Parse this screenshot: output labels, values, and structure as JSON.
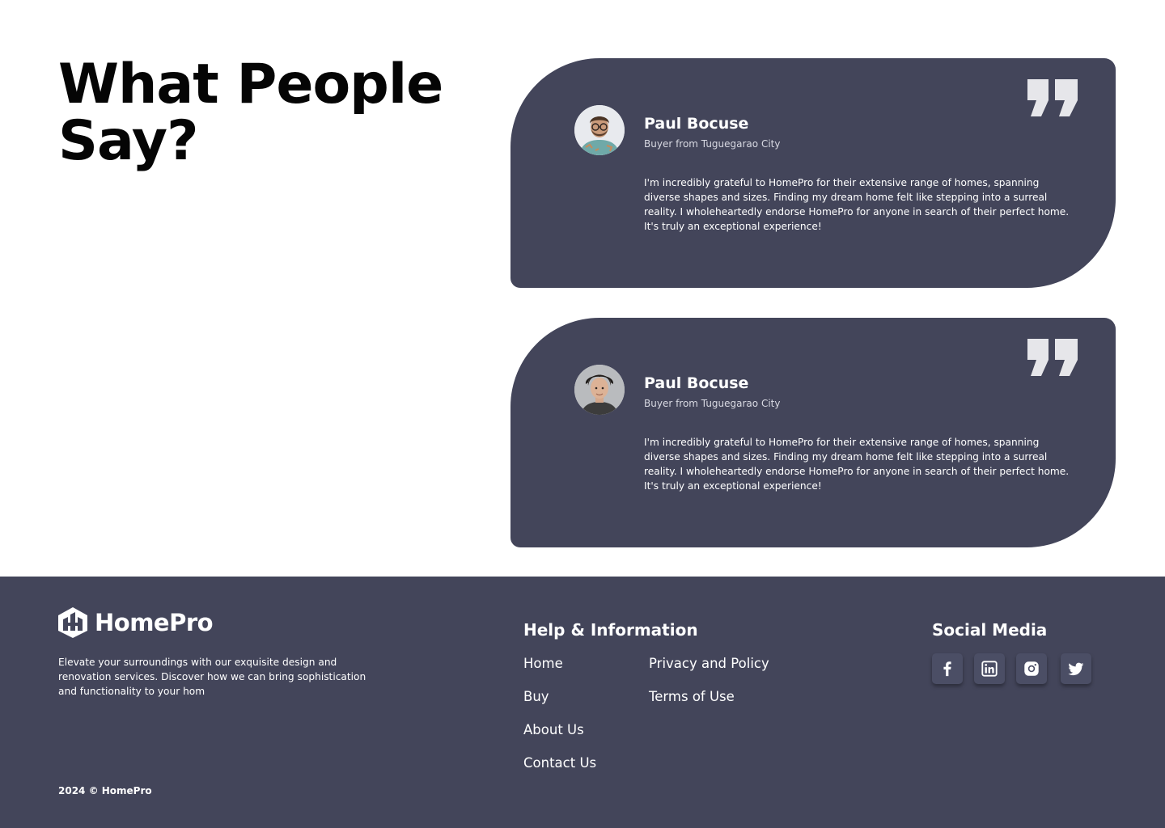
{
  "section": {
    "heading_line1": "What People",
    "heading_line2": "Say?"
  },
  "testimonials": [
    {
      "name": "Paul Bocuse",
      "role": "Buyer from Tuguegarao City",
      "text": "I'm incredibly grateful to HomePro for their extensive range of homes, spanning diverse shapes and sizes. Finding my dream home felt like stepping into a surreal reality. I wholeheartedly endorse HomePro for anyone in search of their perfect home. It's truly an exceptional experience!",
      "avatar_icon": "avatar-man-glasses-icon"
    },
    {
      "name": "Paul Bocuse",
      "role": "Buyer from Tuguegarao City",
      "text": "I'm incredibly grateful to HomePro for their extensive range of homes, spanning diverse shapes and sizes. Finding my dream home felt like stepping into a surreal reality. I wholeheartedly endorse HomePro for anyone in search of their perfect home. It's truly an exceptional experience!",
      "avatar_icon": "avatar-young-man-icon"
    }
  ],
  "footer": {
    "brand": "HomePro",
    "tagline": "Elevate your surroundings with our exquisite design and renovation services. Discover how we can bring sophistication and functionality to your hom",
    "copyright": "2024 © HomePro",
    "help_title": "Help & Information",
    "help_links": [
      "Home",
      "Buy",
      "About Us",
      "Contact Us",
      "Privacy and Policy",
      "Terms of Use"
    ],
    "social_title": "Social Media",
    "social_icons": [
      "facebook-icon",
      "linkedin-icon",
      "instagram-icon",
      "twitter-icon"
    ]
  },
  "colors": {
    "card_bg": "#43455a",
    "footer_bg": "#43455a",
    "social_button_bg": "#4b4e65",
    "quote_icon": "#e6e6ea",
    "heading": "#050505"
  }
}
